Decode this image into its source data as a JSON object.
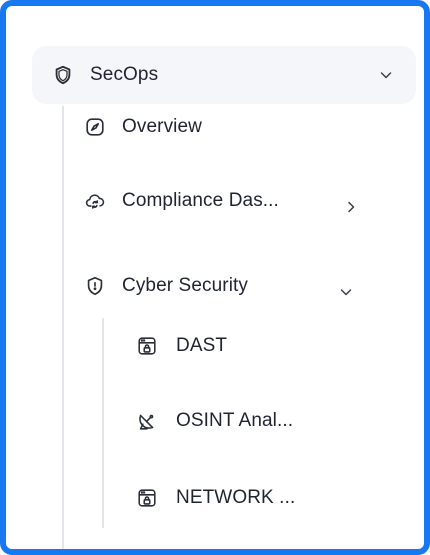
{
  "nav": {
    "root": {
      "label": "SecOps",
      "icon": "shield-icon",
      "expanded": true
    },
    "items": [
      {
        "label": "Overview",
        "icon": "compass-icon"
      },
      {
        "label": "Compliance Das...",
        "icon": "cloud-sync-icon",
        "has_submenu": true,
        "expanded": false
      },
      {
        "label": "Cyber Security",
        "icon": "shield-alert-icon",
        "expanded": true,
        "children": [
          {
            "label": "DAST",
            "icon": "browser-lock-icon"
          },
          {
            "label": "OSINT Anal...",
            "icon": "satellite-dish-icon"
          },
          {
            "label": "NETWORK ...",
            "icon": "browser-lock-icon"
          }
        ]
      }
    ]
  },
  "colors": {
    "frame_border": "#1877f2",
    "header_bg": "#f5f6f9",
    "text": "#1f2430",
    "tree_line": "#e3e5ea"
  }
}
